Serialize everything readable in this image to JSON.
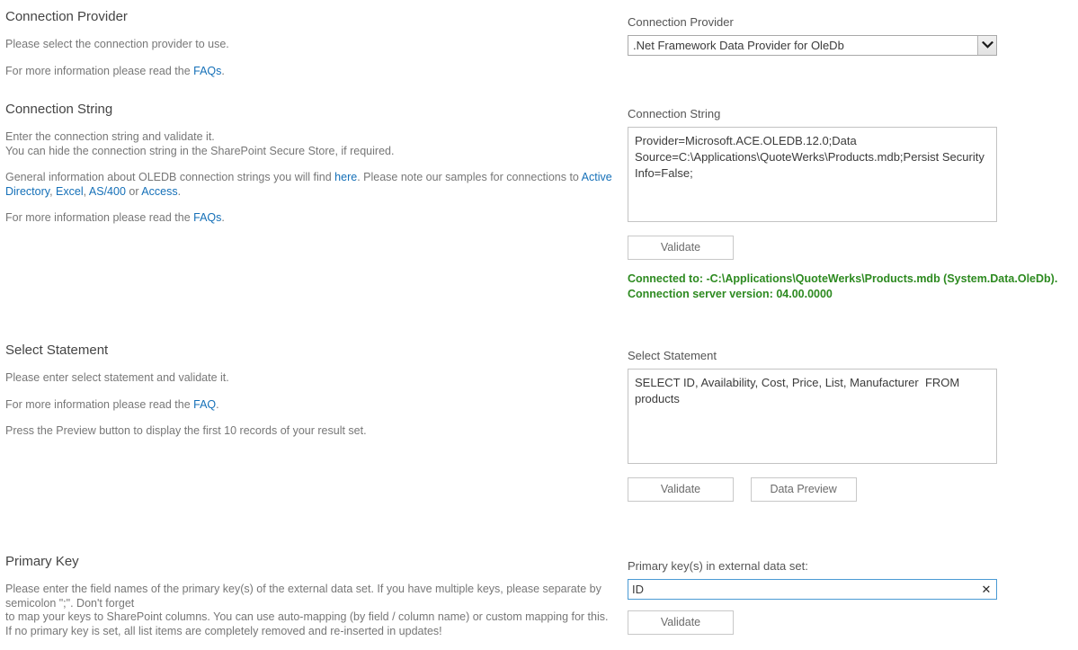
{
  "sections": {
    "connection_provider": {
      "heading": "Connection Provider",
      "para1": "Please select the connection provider to use.",
      "para2_prefix": "For more information please read the ",
      "para2_link": "FAQs",
      "para2_suffix": ".",
      "field_label": "Connection Provider",
      "selected_value": ".Net Framework Data Provider for OleDb",
      "dropdown_icon": "chevron-down-icon"
    },
    "connection_string": {
      "heading": "Connection String",
      "para1_line1": "Enter the connection string and validate it.",
      "para1_line2": "You can hide the connection string in the SharePoint Secure Store, if required.",
      "para2_a": "General information about OLEDB connection strings you will find ",
      "para2_link_here": "here",
      "para2_b": ". Please note our samples for connections to ",
      "para2_link_ad": "Active Directory",
      "para2_c": ", ",
      "para2_link_excel": "Excel",
      "para2_d": ", ",
      "para2_link_as400": "AS/400",
      "para2_e": " or ",
      "para2_link_access": "Access",
      "para2_f": ".",
      "para3_prefix": "For more information please read the ",
      "para3_link": "FAQs",
      "para3_suffix": ".",
      "field_label": "Connection String",
      "value": "Provider=Microsoft.ACE.OLEDB.12.0;Data Source=C:\\Applications\\QuoteWerks\\Products.mdb;Persist Security Info=False;",
      "validate_label": "Validate",
      "status_line1": "Connected to: -C:\\Applications\\QuoteWerks\\Products.mdb (System.Data.OleDb).",
      "status_line2": "Connection server version: 04.00.0000",
      "status_color": "#2d8a20"
    },
    "select_statement": {
      "heading": "Select Statement",
      "para1": "Please enter select statement and validate it.",
      "para2_prefix": "For more information please read the ",
      "para2_link": "FAQ",
      "para2_suffix": ".",
      "para3": "Press the Preview button to display the first 10 records of your result set.",
      "field_label": "Select Statement",
      "value": "SELECT ID, Availability, Cost, Price, List, Manufacturer  FROM products",
      "validate_label": "Validate",
      "preview_label": "Data Preview"
    },
    "primary_key": {
      "heading": "Primary Key",
      "para_line1": "Please enter the field names of the primary key(s) of the external data set. If you have multiple keys, please separate by semicolon \";\". Don't forget",
      "para_line2": "to map your keys to SharePoint columns. You can use auto-mapping (by field / column name) or custom mapping for this.",
      "para_line3": "If no primary key is set, all list items are completely removed and re-inserted in updates!",
      "field_label": "Primary key(s) in external data set:",
      "value": "ID",
      "clear_icon": "close-icon",
      "validate_label": "Validate"
    }
  },
  "colors": {
    "link": "#1570b8",
    "success": "#2d8a20",
    "focus_border": "#4a9ad4"
  }
}
